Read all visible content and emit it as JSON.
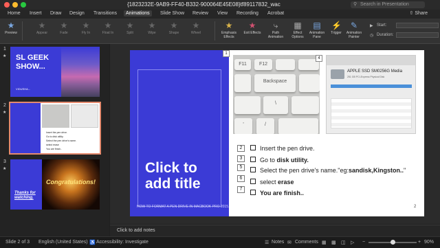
{
  "window": {
    "title": "{1823232E-9AB9-FF40-B332-900064E45E08}tf89117832_wac",
    "search_placeholder": "Search in Presentation"
  },
  "tabs": [
    "Home",
    "Insert",
    "Draw",
    "Design",
    "Transitions",
    "Animations",
    "Slide Show",
    "Review",
    "View",
    "Recording",
    "Acrobat"
  ],
  "active_tab": "Animations",
  "share_label": "Share",
  "ribbon": {
    "preview": "Preview",
    "effects": [
      "Appear",
      "Fade",
      "Fly In",
      "Float In",
      "Split",
      "Wipe",
      "Shape",
      "Wheel",
      "Random Bars",
      "Grow & Turn",
      "Zoom"
    ],
    "effect_groups": [
      "Emphasis Effects",
      "Exit Effects",
      "Path Animation",
      "Effect Options",
      "Animation Pane",
      "Trigger",
      "Animation Painter"
    ],
    "start_label": "Start:",
    "duration_label": "Duration:"
  },
  "thumbnails": [
    {
      "num": "1",
      "title": "SL GEEK SHOW...",
      "sub": "VIDUSHA..."
    },
    {
      "num": "2",
      "lines": [
        "Insert the pen drive.",
        "Go to disk utility.",
        "Select the pen drive's name.",
        "select erase",
        "You are finish.."
      ]
    },
    {
      "num": "3",
      "title": "Thanks for watching.",
      "banner": "Congratulations!"
    }
  ],
  "slide": {
    "title": "Click to add title",
    "footer": "HOW TO FORMAT A PEN DRIVE IN MACBOOK PRO 2015.",
    "page": "2",
    "badges": {
      "keyboard": "1",
      "screenshot": "4"
    },
    "keys": [
      "F11",
      "F12",
      "Backspace",
      "\\",
      "'",
      "/"
    ],
    "mac_title": "APPLE SSD SM0256G Media",
    "mac_sub": "251 GB PCI-Express Physical Disk",
    "steps": [
      {
        "num": "2",
        "pre": "Insert the pen drive.",
        "bold": "",
        "post": ""
      },
      {
        "num": "3",
        "pre": "Go to ",
        "bold": "disk utility.",
        "post": ""
      },
      {
        "num": "5",
        "pre": "Select the pen drive's name.\"eg:",
        "bold": "sandisk,Kingston..",
        "post": "\""
      },
      {
        "num": "6",
        "pre": "select ",
        "bold": "erase",
        "post": ""
      },
      {
        "num": "7",
        "pre": "",
        "bold": "You are finish..",
        "post": ""
      }
    ]
  },
  "notes_placeholder": "Click to add notes",
  "status": {
    "slide_of": "Slide 2 of 3",
    "language": "English (United States)",
    "accessibility": "Accessibility: Investigate",
    "notes": "Notes",
    "comments": "Comments",
    "zoom": "90%"
  },
  "colors": {
    "slide_accent": "#3b3bd6",
    "selection": "#e58a6e",
    "ribbon_active_icon": "#d05070"
  }
}
